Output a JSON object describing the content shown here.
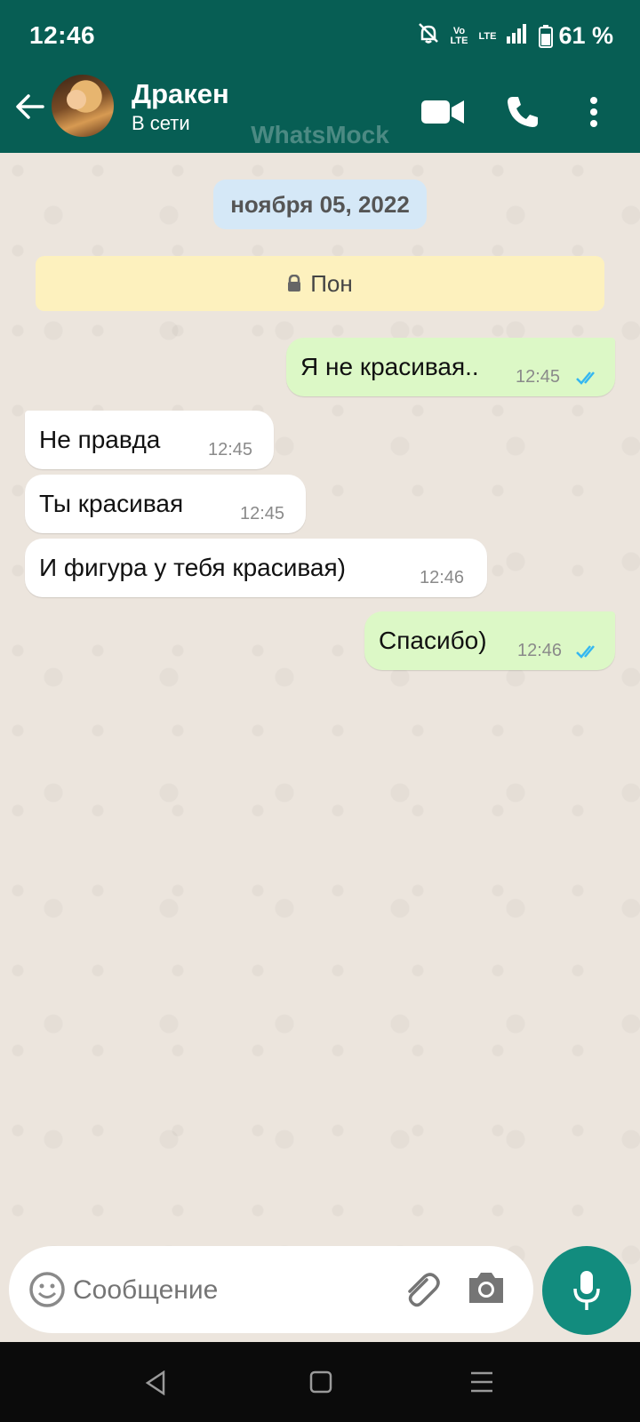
{
  "status_bar": {
    "time": "12:46",
    "network": "LTE",
    "volte": "Vo LTE",
    "battery": "61 %",
    "icons": [
      "mute-icon",
      "volte-icon",
      "lte-icon",
      "signal-icon",
      "battery-icon"
    ]
  },
  "header": {
    "contact_name": "Дракен",
    "contact_status": "В сети",
    "watermark": "WhatsMock",
    "icons": [
      "back-arrow-icon",
      "video-call-icon",
      "phone-call-icon",
      "more-vertical-icon"
    ]
  },
  "chat": {
    "date_label": "ноября 05, 2022",
    "encryption_notice": "Пон",
    "messages": [
      {
        "direction": "out",
        "text": "Я не красивая..",
        "time": "12:45",
        "read": true
      },
      {
        "direction": "in",
        "text": "Не правда",
        "time": "12:45"
      },
      {
        "direction": "in",
        "text": "Ты красивая",
        "time": "12:45"
      },
      {
        "direction": "in",
        "text": "И фигура у тебя красивая)",
        "time": "12:46"
      },
      {
        "direction": "out",
        "text": "Спасибо)",
        "time": "12:46",
        "read": true
      }
    ]
  },
  "composer": {
    "placeholder": "Сообщение",
    "icons": [
      "emoji-icon",
      "attach-icon",
      "camera-icon",
      "mic-icon"
    ]
  },
  "nav_bar": {
    "icons": [
      "back-triangle-icon",
      "home-square-icon",
      "recents-menu-icon"
    ]
  },
  "colors": {
    "header_bg": "#075e54",
    "accent": "#128c7e",
    "outgoing_bubble": "#dcf8c6",
    "incoming_bubble": "#ffffff",
    "date_chip": "#d5e8f7",
    "notice_bg": "#fdf1be",
    "read_ticks": "#34b7f1"
  }
}
